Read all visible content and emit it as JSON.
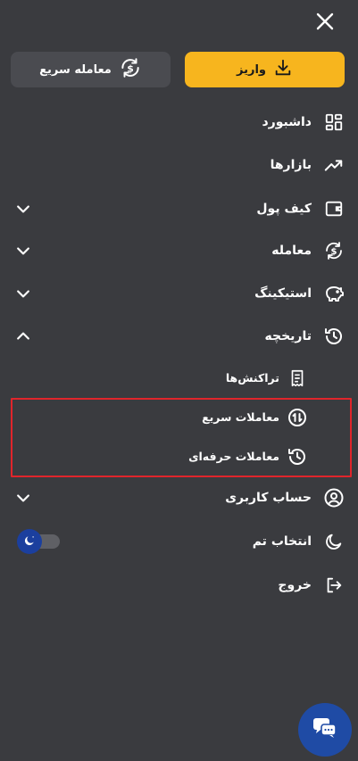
{
  "header": {
    "close_icon": "close-icon"
  },
  "actions": {
    "deposit_label": "واریز",
    "quick_trade_label": "معامله سریع"
  },
  "menu": {
    "dashboard": "داشبورد",
    "markets": "بازارها",
    "wallet": "کیف پول",
    "trade": "معامله",
    "staking": "استیکینگ",
    "history": "تاریخچه",
    "account": "حساب کاربری",
    "theme": "انتخاب تم",
    "logout": "خروج"
  },
  "history_submenu": {
    "transactions": "تراکنش‌ها",
    "quick_trades": "معاملات سریع",
    "pro_trades": "معاملات حرفه‌ای"
  },
  "theme_toggle": {
    "mode": "dark",
    "enabled": true
  },
  "colors": {
    "background": "#3a3b3f",
    "accent": "#f7b51e",
    "secondary_button": "#4a4b50",
    "highlight_border": "#e0252b",
    "chat_button": "#1f4ba5"
  }
}
